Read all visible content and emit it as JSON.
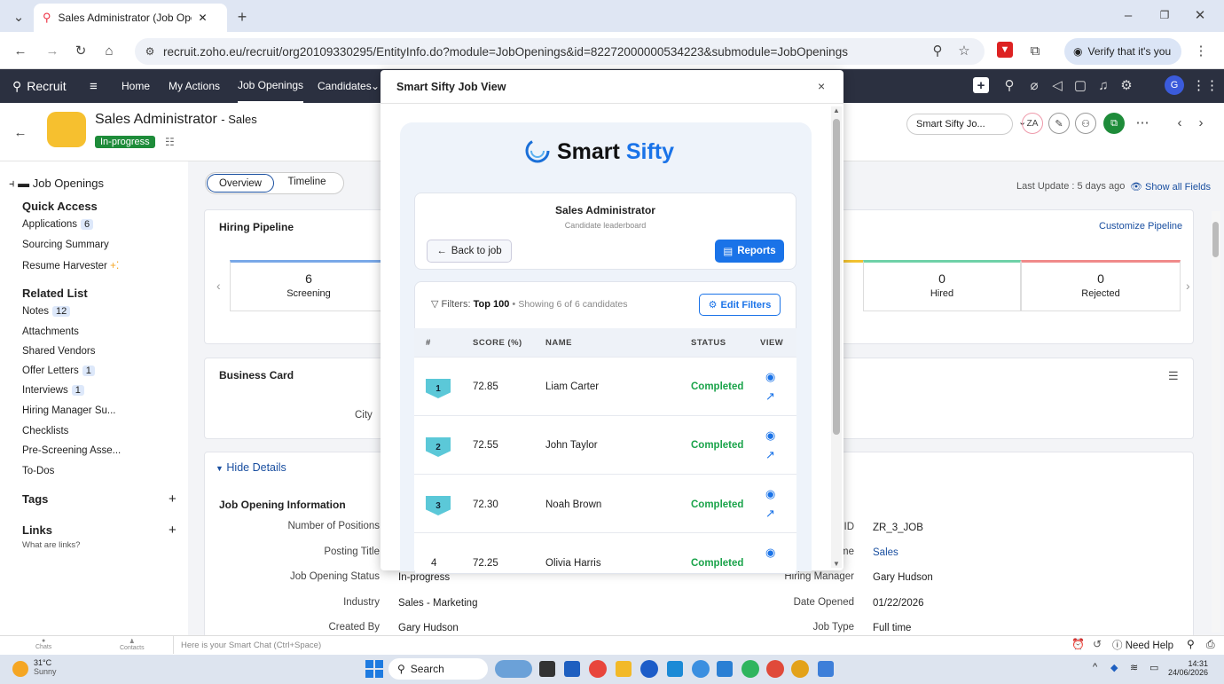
{
  "browser": {
    "tab_title": "Sales Administrator (Job Openi",
    "url": "recruit.zoho.eu/recruit/org20109330295/EntityInfo.do?module=JobOpenings&id=82272000000534223&submodule=JobOpenings",
    "verify": "Verify that it's you"
  },
  "nav": {
    "app": "Recruit",
    "items": [
      "Home",
      "My Actions",
      "Job Openings",
      "Candidates"
    ]
  },
  "header": {
    "title": "Sales Administrator",
    "dept": "- Sales",
    "status": "In-progress",
    "smart_select": "Smart Sifty Jo...",
    "last_update": "Last Update : 5 days ago",
    "show_all": "Show all Fields"
  },
  "sidebar": {
    "back": "Job Openings",
    "quick_access": "Quick Access",
    "quick": [
      {
        "label": "Applications",
        "count": "6"
      },
      {
        "label": "Sourcing Summary",
        "count": ""
      },
      {
        "label": "Resume Harvester",
        "count": ""
      }
    ],
    "related_list": "Related List",
    "related": [
      {
        "label": "Notes",
        "count": "12"
      },
      {
        "label": "Attachments",
        "count": ""
      },
      {
        "label": "Shared Vendors",
        "count": ""
      },
      {
        "label": "Offer Letters",
        "count": "1"
      },
      {
        "label": "Interviews",
        "count": "1"
      },
      {
        "label": "Hiring Manager Su...",
        "count": ""
      },
      {
        "label": "Checklists",
        "count": ""
      },
      {
        "label": "Pre-Screening Asse...",
        "count": ""
      },
      {
        "label": "To-Dos",
        "count": ""
      }
    ],
    "tags": "Tags",
    "links": "Links",
    "links_help": "What are links?"
  },
  "main": {
    "tabs": [
      "Overview",
      "Timeline"
    ],
    "pipeline_title": "Hiring Pipeline",
    "customize": "Customize Pipeline",
    "stages": [
      {
        "count": "6",
        "label": "Screening"
      },
      {
        "count": "0",
        "label": "Hired"
      },
      {
        "count": "0",
        "label": "Rejected"
      }
    ],
    "business_card": "Business Card",
    "city": "City",
    "hide_details": "Hide Details",
    "job_info": "Job Opening Information",
    "fields_left": [
      {
        "label": "Number of Positions",
        "value": ""
      },
      {
        "label": "Posting Title",
        "value": ""
      },
      {
        "label": "Job Opening Status",
        "value": "In-progress"
      },
      {
        "label": "Industry",
        "value": "Sales - Marketing"
      },
      {
        "label": "Created By",
        "value": "Gary Hudson"
      }
    ],
    "fields_right": [
      {
        "label": "ID",
        "value": "ZR_3_JOB"
      },
      {
        "label": "me",
        "value": "Sales"
      },
      {
        "label": "Hiring Manager",
        "value": "Gary Hudson"
      },
      {
        "label": "Date Opened",
        "value": "01/22/2026"
      },
      {
        "label": "Job Type",
        "value": "Full time"
      }
    ]
  },
  "modal": {
    "title": "Smart Sifty Job View",
    "brand1": "Smart",
    "brand2": "Sifty",
    "job": "Sales Administrator",
    "subtitle": "Candidate leaderboard",
    "back": "Back to job",
    "reports": "Reports",
    "filters_label": "Filters:",
    "filters_value": "Top 100",
    "showing": "Showing 6 of 6 candidates",
    "edit_filters": "Edit Filters",
    "columns": [
      "#",
      "SCORE (%)",
      "NAME",
      "STATUS",
      "VIEW"
    ],
    "rows": [
      {
        "rank": "1",
        "score": "72.85",
        "name": "Liam Carter",
        "status": "Completed"
      },
      {
        "rank": "2",
        "score": "72.55",
        "name": "John Taylor",
        "status": "Completed"
      },
      {
        "rank": "3",
        "score": "72.30",
        "name": "Noah Brown",
        "status": "Completed"
      },
      {
        "rank": "4",
        "score": "72.25",
        "name": "Olivia Harris",
        "status": "Completed"
      }
    ]
  },
  "chat": {
    "placeholder": "Here is your Smart Chat (Ctrl+Space)",
    "chats": "Chats",
    "contacts": "Contacts",
    "need_help": "Need Help"
  },
  "taskbar": {
    "temp": "31°C",
    "weather": "Sunny",
    "search": "Search",
    "time": "14:31",
    "date": "24/06/2026"
  }
}
